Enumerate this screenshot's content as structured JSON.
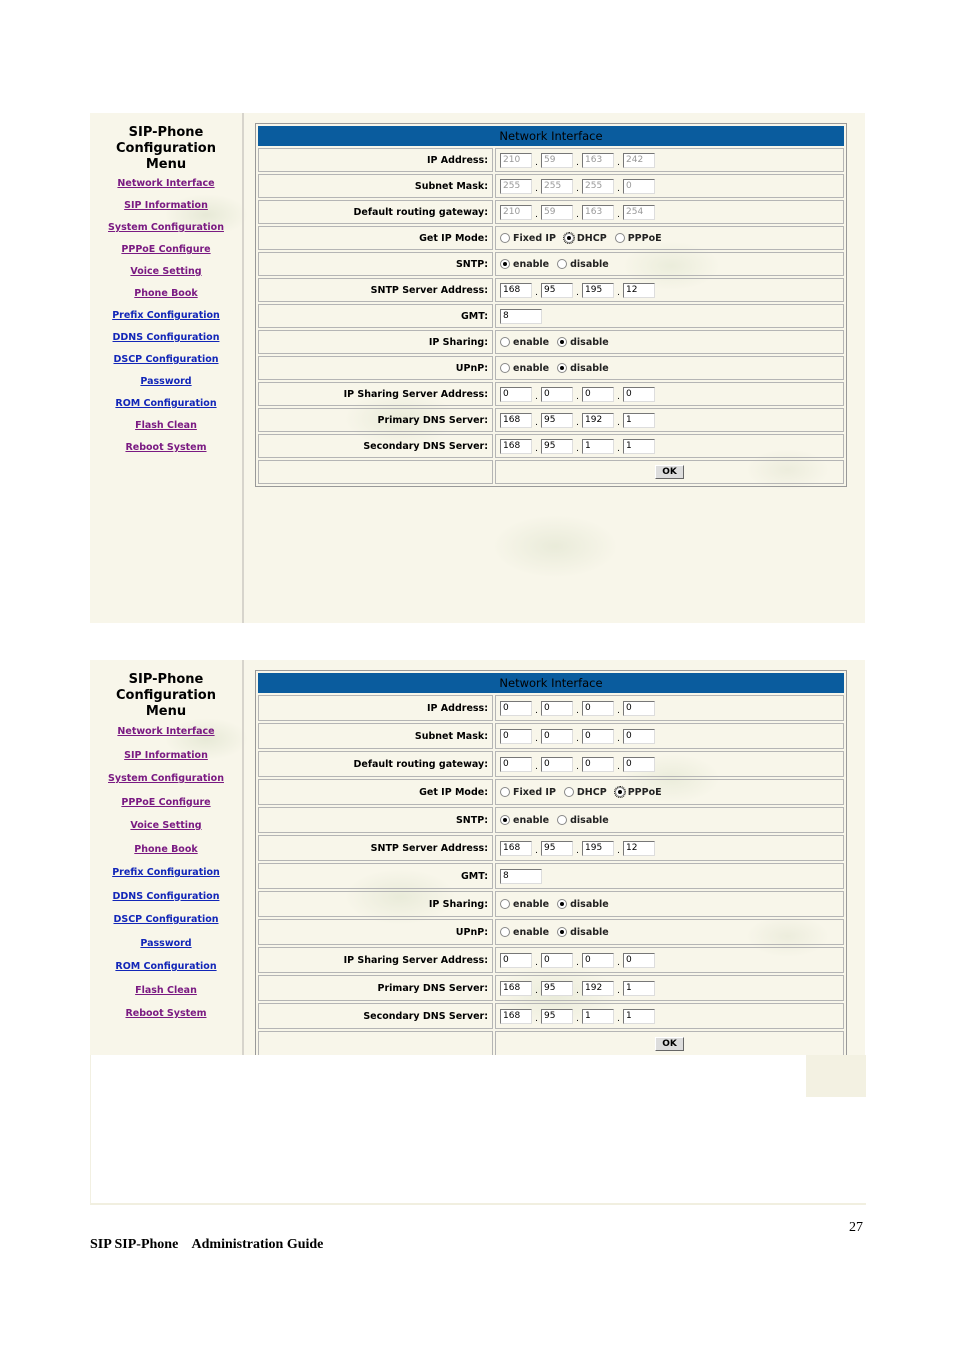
{
  "menu": {
    "title_line1": "SIP-Phone",
    "title_line2": "Configuration",
    "title_line3": "Menu",
    "items": [
      {
        "label": "Network Interface",
        "state": "visited"
      },
      {
        "label": "SIP Information",
        "state": "visited"
      },
      {
        "label": "System Configuration",
        "state": "visited"
      },
      {
        "label": "PPPoE Configure",
        "state": "visited"
      },
      {
        "label": "Voice Setting",
        "state": "visited"
      },
      {
        "label": "Phone Book",
        "state": "visited"
      },
      {
        "label": "Prefix Configuration",
        "state": "unvisited"
      },
      {
        "label": "DDNS Configuration",
        "state": "unvisited"
      },
      {
        "label": "DSCP Configuration",
        "state": "unvisited"
      },
      {
        "label": "Password",
        "state": "unvisited"
      },
      {
        "label": "ROM Configuration",
        "state": "unvisited"
      },
      {
        "label": "Flash Clean",
        "state": "visited"
      },
      {
        "label": "Reboot System",
        "state": "visited"
      }
    ]
  },
  "labels": {
    "panel_title": "Network Interface",
    "ip_address": "IP Address:",
    "subnet_mask": "Subnet Mask:",
    "gateway": "Default routing gateway:",
    "get_ip_mode": "Get IP Mode:",
    "sntp": "SNTP:",
    "sntp_server": "SNTP Server Address:",
    "gmt": "GMT:",
    "ip_sharing": "IP Sharing:",
    "upnp": "UPnP:",
    "ip_sharing_server": "IP Sharing Server Address:",
    "primary_dns": "Primary DNS Server:",
    "secondary_dns": "Secondary DNS Server:",
    "fixed_ip": "Fixed IP",
    "dhcp": "DHCP",
    "pppoe": "PPPoE",
    "enable": "enable",
    "disable": "disable",
    "ok": "OK",
    "dot": "."
  },
  "screens": [
    {
      "ip_mode": "DHCP",
      "ip_address": [
        "210",
        "59",
        "163",
        "242"
      ],
      "subnet_mask": [
        "255",
        "255",
        "255",
        "0"
      ],
      "gateway": [
        "210",
        "59",
        "163",
        "254"
      ],
      "sntp": "enable",
      "sntp_server": [
        "168",
        "95",
        "195",
        "12"
      ],
      "gmt": "8",
      "ip_sharing": "disable",
      "upnp": "disable",
      "ip_sharing_server": [
        "0",
        "0",
        "0",
        "0"
      ],
      "primary_dns": [
        "168",
        "95",
        "192",
        "1"
      ],
      "secondary_dns": [
        "168",
        "95",
        "1",
        "1"
      ]
    },
    {
      "ip_mode": "PPPoE",
      "ip_address": [
        "0",
        "0",
        "0",
        "0"
      ],
      "subnet_mask": [
        "0",
        "0",
        "0",
        "0"
      ],
      "gateway": [
        "0",
        "0",
        "0",
        "0"
      ],
      "sntp": "enable",
      "sntp_server": [
        "168",
        "95",
        "195",
        "12"
      ],
      "gmt": "8",
      "ip_sharing": "disable",
      "upnp": "disable",
      "ip_sharing_server": [
        "0",
        "0",
        "0",
        "0"
      ],
      "primary_dns": [
        "168",
        "95",
        "192",
        "1"
      ],
      "secondary_dns": [
        "168",
        "95",
        "1",
        "1"
      ]
    }
  ],
  "page": {
    "number": "27",
    "footer": "SIP SIP-Phone    Administration Guide"
  }
}
